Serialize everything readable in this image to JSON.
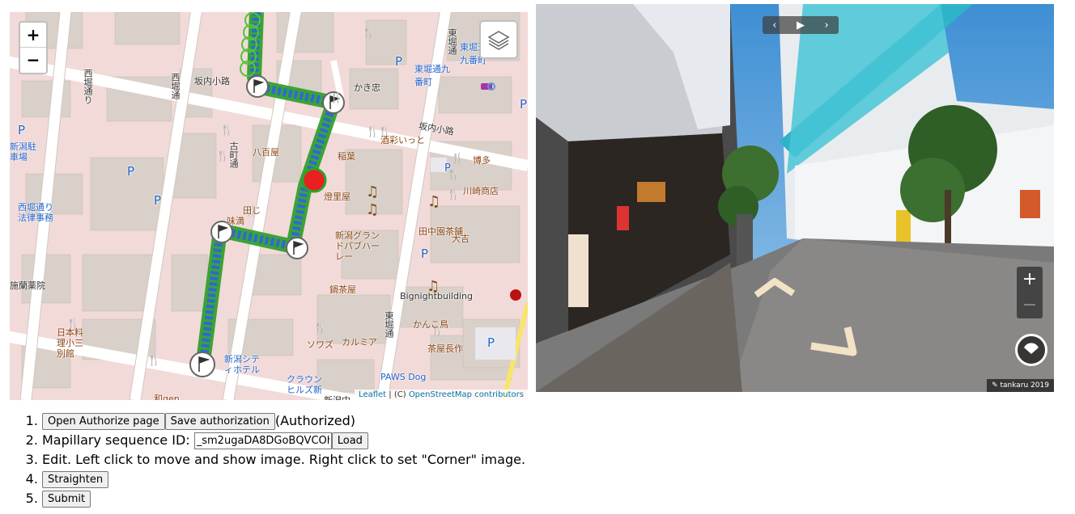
{
  "map": {
    "zoom_in": "+",
    "zoom_out": "−",
    "icons": {
      "layers": "layers-icon",
      "flag": "flag-marker-icon",
      "current": "current-position-marker-icon"
    },
    "colors": {
      "road": "#ffffff",
      "building": "#d9d0c9",
      "block": "#f2dad9",
      "route_fill": "#2b7fd0",
      "route_stroke": "#31a02c",
      "current": "#e8201f"
    },
    "labels": {
      "sakanaikoji_n": "坂内小路",
      "sakanaikoji_e": "坂内小路",
      "nishihoridori": "西堀通り",
      "nishihori_dori2": "西堀通",
      "furumachidori": "古町通",
      "higashihori": "東堀通",
      "higashihori2": "東堀通",
      "higashibori_bus": "東堀通九番町",
      "higashibori_bus2": "東堀通九番町",
      "kakichu": "かき忠",
      "hyakushoku": "八百屋",
      "inaba": "稲葉",
      "sakaihiko": "酒彩いっと",
      "hakata": "博多",
      "kawasaki": "川崎商店",
      "toriya": "燈里屋",
      "niigata_grand": "新潟グランドパブハーレー",
      "tanaka": "田中園茶舗",
      "daikichi": "大吉",
      "bignight": "Bignightbuilding",
      "nabecha": "鍋茶屋",
      "kankodori": "かんこ鳥",
      "chaya": "茶屋長作",
      "sowazu": "ソワズ",
      "karumia": "カルミア",
      "niigata_city_hotel": "新潟シティホテル",
      "crown": "クラウンヒルズ新",
      "paws": "PAWS Dog",
      "nihonryori": "日本料理小三別館",
      "shiyakusho": "新潟駐車場",
      "seikatsu": "西堀通り法律事務",
      "shiseido": "施蘭薬院",
      "wagen": "和qen",
      "tenmaru": "田じ",
      "sushi": "味満",
      "shirayuri": "新潟中",
      "p1": "P",
      "p2": "P",
      "p3": "P",
      "p4": "P",
      "p5": "P",
      "p6": "P",
      "p7": "P",
      "p8": "P"
    },
    "attribution_leaflet": "Leaflet",
    "attribution_sep": " | (C) ",
    "attribution_osm": "OpenStreetMap contributors"
  },
  "viewer": {
    "prev": "‹",
    "play": "▶",
    "next": "›",
    "zoom_in": "+",
    "zoom_out": "−",
    "credit": "tankaru 2019",
    "icons": {
      "compass": "compass-icon",
      "credit": "user-icon"
    }
  },
  "steps": {
    "s1": {
      "open_authorize": "Open Authorize page",
      "save_auth": "Save authorization",
      "status": "(Authorized)"
    },
    "s2": {
      "label": "Mapillary sequence ID:",
      "value": "_sm2ugaDA8DGoBQVCOh0",
      "load": "Load"
    },
    "s3": {
      "text": "Edit. Left click to move and show image. Right click to set \"Corner\" image."
    },
    "s4": {
      "straighten": "Straighten"
    },
    "s5": {
      "submit": "Submit"
    }
  }
}
